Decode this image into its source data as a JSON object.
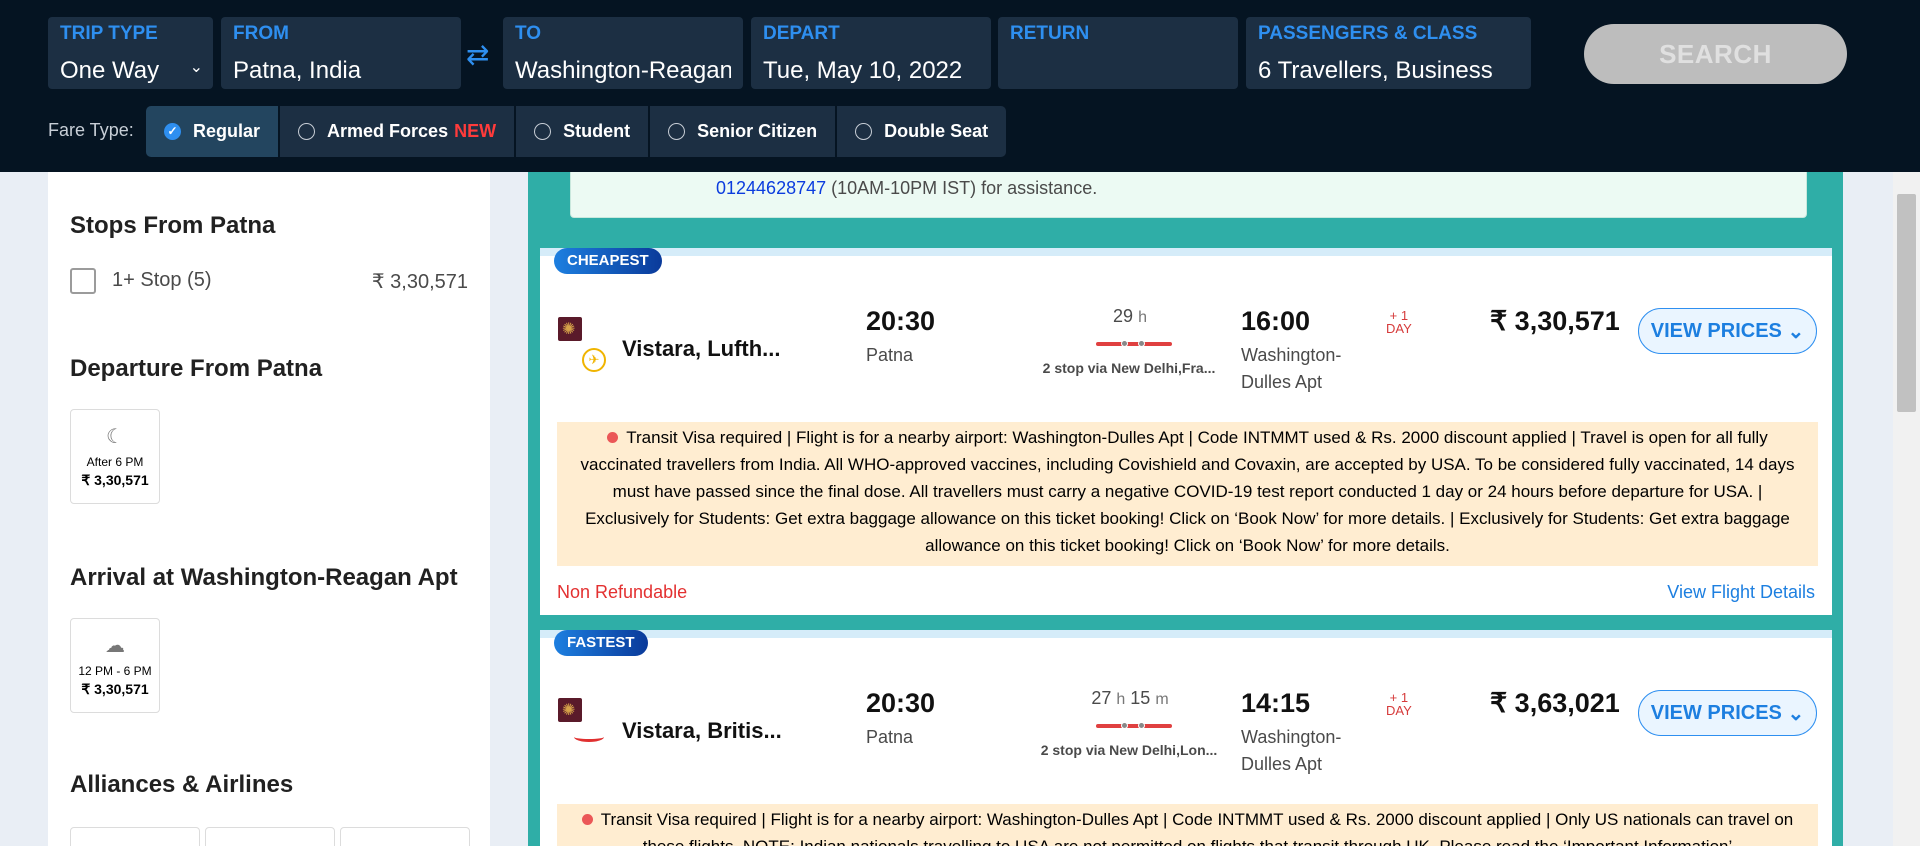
{
  "header": {
    "trip_type": {
      "label": "TRIP TYPE",
      "value": "One Way"
    },
    "from": {
      "label": "FROM",
      "value": "Patna, India"
    },
    "to": {
      "label": "TO",
      "value": "Washington-Reagan"
    },
    "depart": {
      "label": "DEPART",
      "value": "Tue, May 10, 2022"
    },
    "return": {
      "label": "RETURN",
      "value": ""
    },
    "passengers": {
      "label": "PASSENGERS & CLASS",
      "value": "6 Travellers, Business"
    },
    "search_label": "SEARCH",
    "fare_type_label": "Fare Type:",
    "fares": [
      {
        "label": "Regular",
        "selected": true
      },
      {
        "label": "Armed Forces",
        "badge": "NEW"
      },
      {
        "label": "Student"
      },
      {
        "label": "Senior Citizen"
      },
      {
        "label": "Double Seat"
      }
    ]
  },
  "sidebar": {
    "stops_title": "Stops From Patna",
    "stop_option": "1+ Stop (5)",
    "stop_price": "₹ 3,30,571",
    "departure_title": "Departure From Patna",
    "departure_tile": {
      "time": "After 6 PM",
      "price": "₹ 3,30,571"
    },
    "arrival_title": "Arrival at Washington-Reagan Apt",
    "arrival_tile": {
      "time": "12 PM - 6 PM",
      "price": "₹ 3,30,571"
    },
    "alliances_title": "Alliances & Airlines"
  },
  "banner": {
    "phone": "01244628747",
    "text": " (10AM-10PM IST) for assistance."
  },
  "flights": [
    {
      "tag": "CHEAPEST",
      "airline": "Vistara, Lufth...",
      "dep_time": "20:30",
      "dep_city": "Patna",
      "duration_h": "29",
      "duration_m": "",
      "via": "2 stop via New Delhi,Fra...",
      "arr_time": "16:00",
      "arr_city_1": "Washington-",
      "arr_city_2": "Dulles Apt",
      "plus_day_1": "+ 1",
      "plus_day_2": "DAY",
      "price": "₹ 3,30,571",
      "view_prices": "VIEW PRICES",
      "note": "Transit Visa required | Flight is for a nearby airport: Washington-Dulles Apt | Code INTMMT used & Rs. 2000 discount applied | Travel is open for all fully vaccinated travellers from India. All WHO-approved vaccines, including Covishield and Covaxin, are accepted by USA. To be considered fully vaccinated, 14 days must have passed since the final dose. All travellers must carry a negative COVID-19 test report conducted 1 day or 24 hours before departure for USA. | Exclusively for Students: Get extra baggage allowance on this ticket booking! Click on ‘Book Now’ for more details. | Exclusively for Students: Get extra baggage allowance on this ticket booking! Click on ‘Book Now’ for more details.",
      "refund": "Non Refundable",
      "details_link": "View Flight Details"
    },
    {
      "tag": "FASTEST",
      "airline": "Vistara, Britis...",
      "dep_time": "20:30",
      "dep_city": "Patna",
      "duration_h": "27",
      "duration_m": "15",
      "via": "2 stop via New Delhi,Lon...",
      "arr_time": "14:15",
      "arr_city_1": "Washington-",
      "arr_city_2": "Dulles Apt",
      "plus_day_1": "+ 1",
      "plus_day_2": "DAY",
      "price": "₹ 3,63,021",
      "view_prices": "VIEW PRICES",
      "note": "Transit Visa required | Flight is for a nearby airport: Washington-Dulles Apt | Code INTMMT used & Rs. 2000 discount applied | Only US nationals can travel on these flights. NOTE: Indian nationals travelling to USA are not permitted on flights that transit through UK. Please read the ‘Important Information’"
    }
  ],
  "units": {
    "h": "h",
    "m": "m"
  },
  "colors": {
    "header_bg": "#051422",
    "field_bg": "#1c2f43",
    "accent": "#2e8ff0",
    "main_bg": "#2faea7",
    "note_bg": "#ffedd1",
    "alert": "#e33030"
  }
}
